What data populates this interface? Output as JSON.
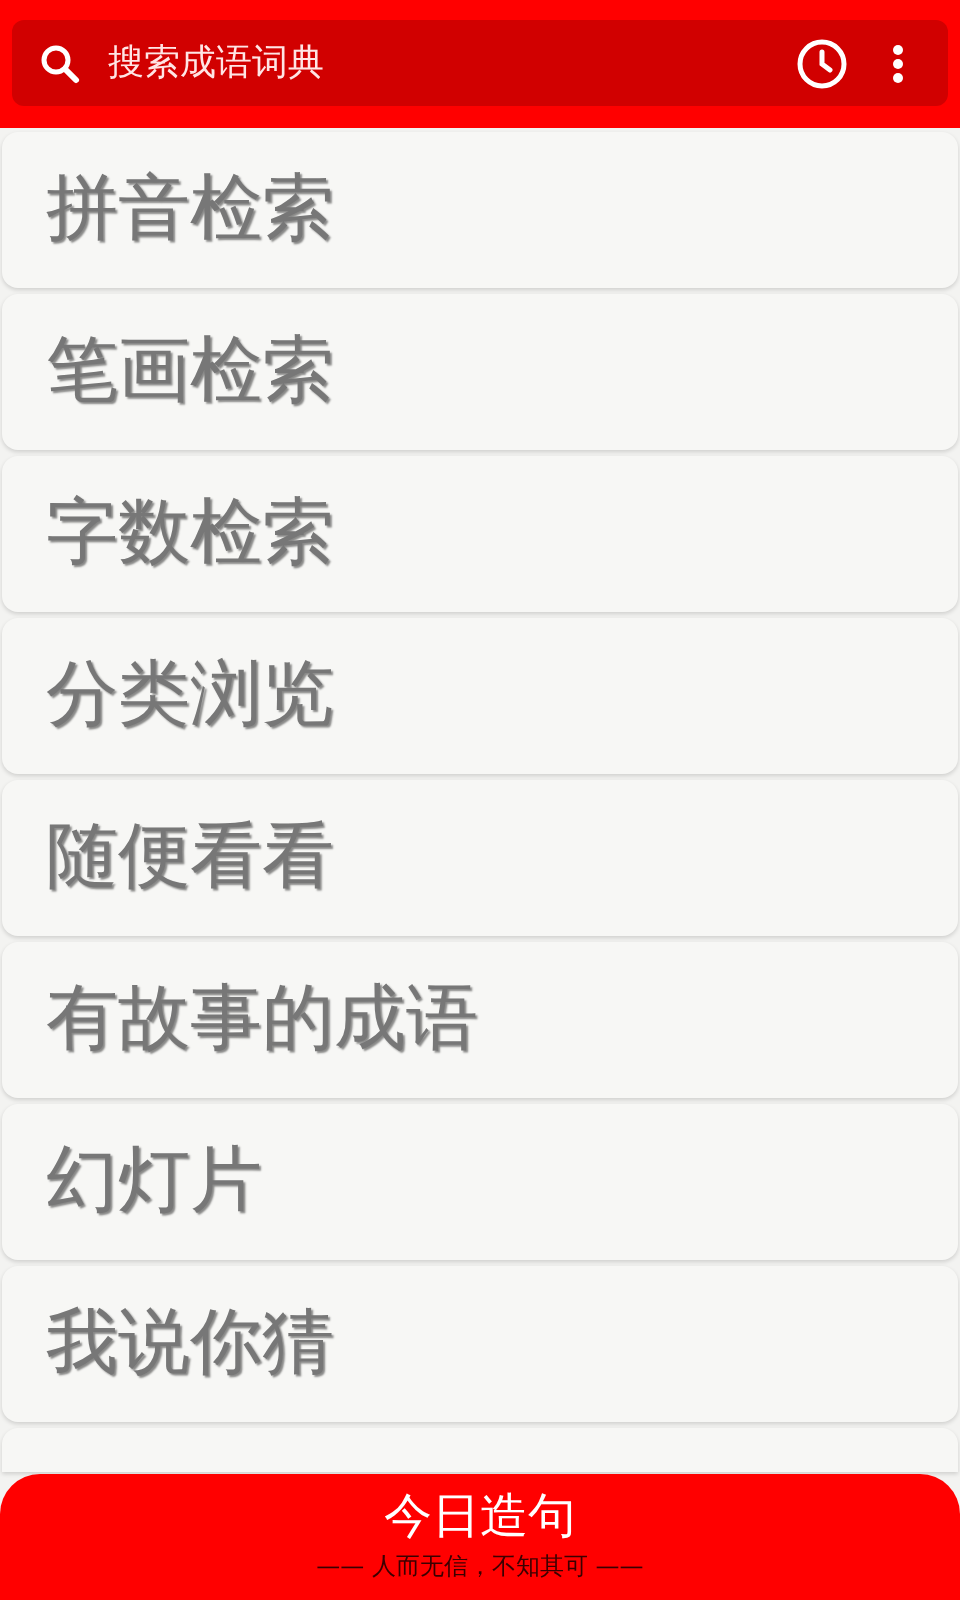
{
  "search": {
    "placeholder": "搜索成语词典"
  },
  "menu_items": [
    {
      "label": "拼音检索"
    },
    {
      "label": "笔画检索"
    },
    {
      "label": "字数检索"
    },
    {
      "label": "分类浏览"
    },
    {
      "label": "随便看看"
    },
    {
      "label": "有故事的成语"
    },
    {
      "label": "幻灯片"
    },
    {
      "label": "我说你猜"
    }
  ],
  "daily_sentence": {
    "title": "今日造句",
    "subtitle": "—— 人而无信，不知其可 ——"
  }
}
